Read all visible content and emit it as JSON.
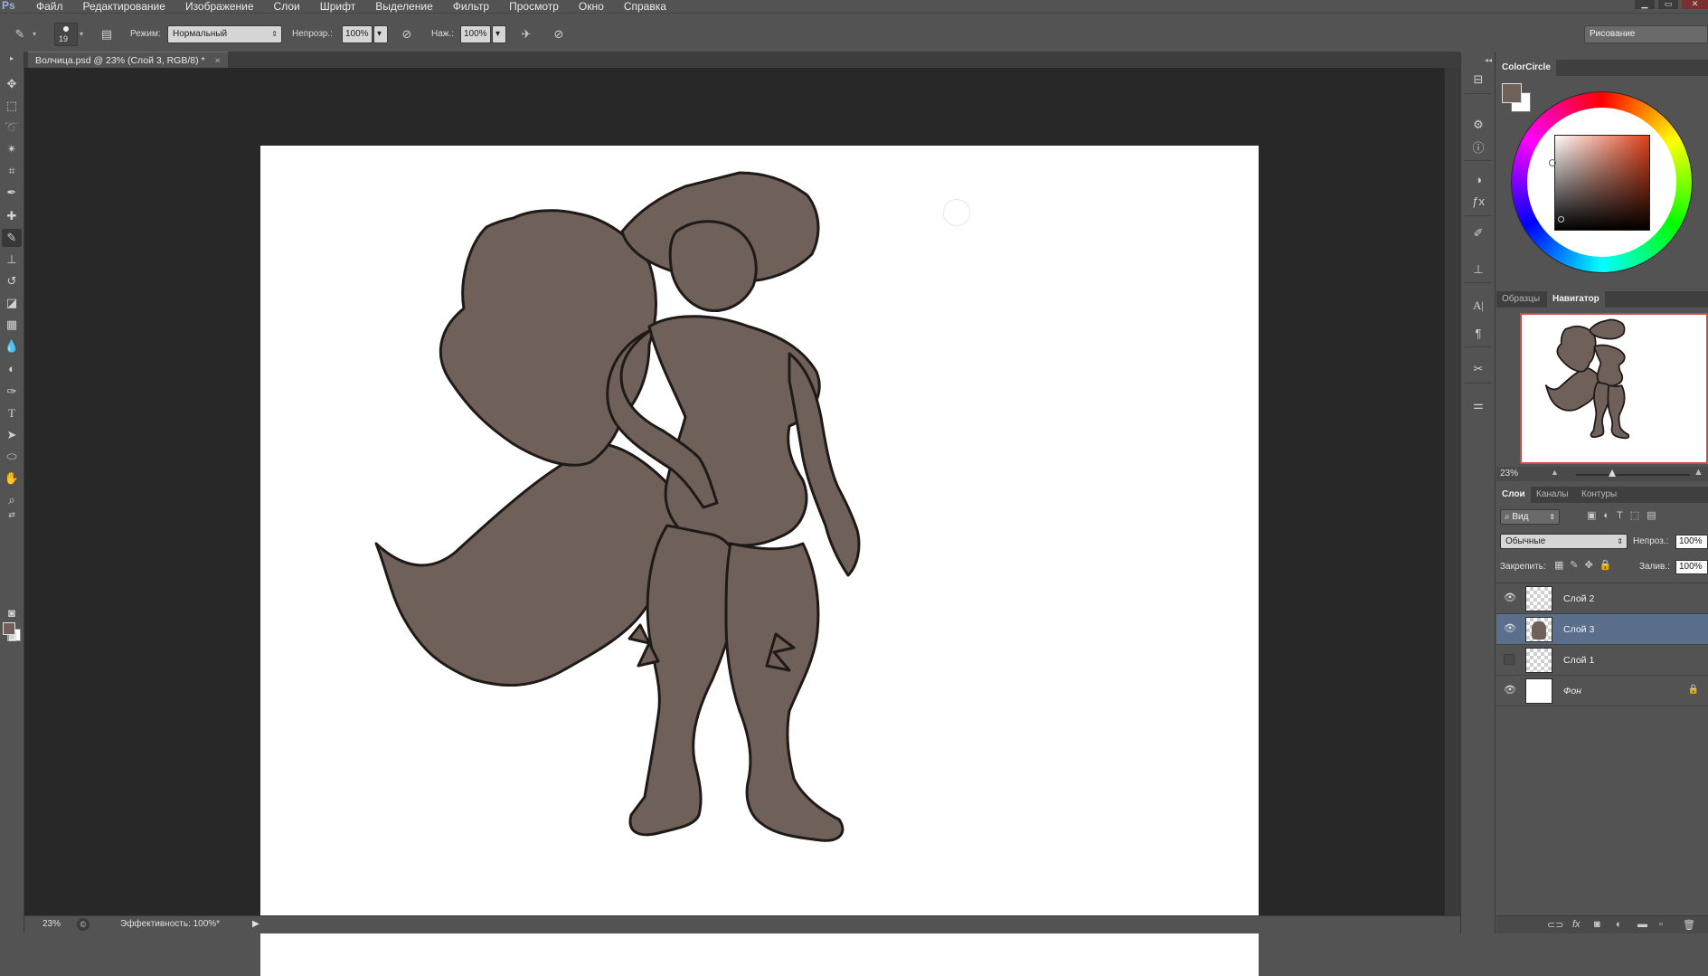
{
  "app": {
    "logo": "Ps"
  },
  "menu": [
    "Файл",
    "Редактирование",
    "Изображение",
    "Слои",
    "Шрифт",
    "Выделение",
    "Фильтр",
    "Просмотр",
    "Окно",
    "Справка"
  ],
  "options_bar": {
    "brush_size": "19",
    "mode_label": "Режим:",
    "mode_value": "Нормальный",
    "opacity_label": "Непрозр.:",
    "opacity_value": "100%",
    "pressure_label": "Наж.:",
    "pressure_value": "100%",
    "workspace_label": "Рисование"
  },
  "document": {
    "tab_title": "Волчица.psd @ 23% (Слой 3, RGB/8) *",
    "close_glyph": "×",
    "fill_color": "#6f615a",
    "line_color": "#1f1a18"
  },
  "status": {
    "zoom": "23%",
    "efficiency": "Эффективность: 100%*"
  },
  "colorcircle": {
    "title": "ColorCircle",
    "foreground": "#6f615a",
    "background": "#ffffff",
    "square_hue": "#e0401a"
  },
  "navigator": {
    "tab_swatches": "Образцы",
    "tab_navigator": "Навигатор",
    "zoom": "23%"
  },
  "layers": {
    "tab_layers": "Слои",
    "tab_channels": "Каналы",
    "tab_paths": "Контуры",
    "filter_label": "Вид",
    "blend_mode": "Обычные",
    "opacity_label": "Непроз.:",
    "opacity_value": "100%",
    "lock_label": "Закрепить:",
    "fill_label": "Залив.:",
    "fill_value": "100%",
    "items": [
      {
        "name": "Слой 2",
        "visible": true,
        "selected": false
      },
      {
        "name": "Слой 3",
        "visible": true,
        "selected": true
      },
      {
        "name": "Слой 1",
        "visible": false,
        "selected": false
      },
      {
        "name": "Фон",
        "visible": true,
        "selected": false
      }
    ]
  }
}
